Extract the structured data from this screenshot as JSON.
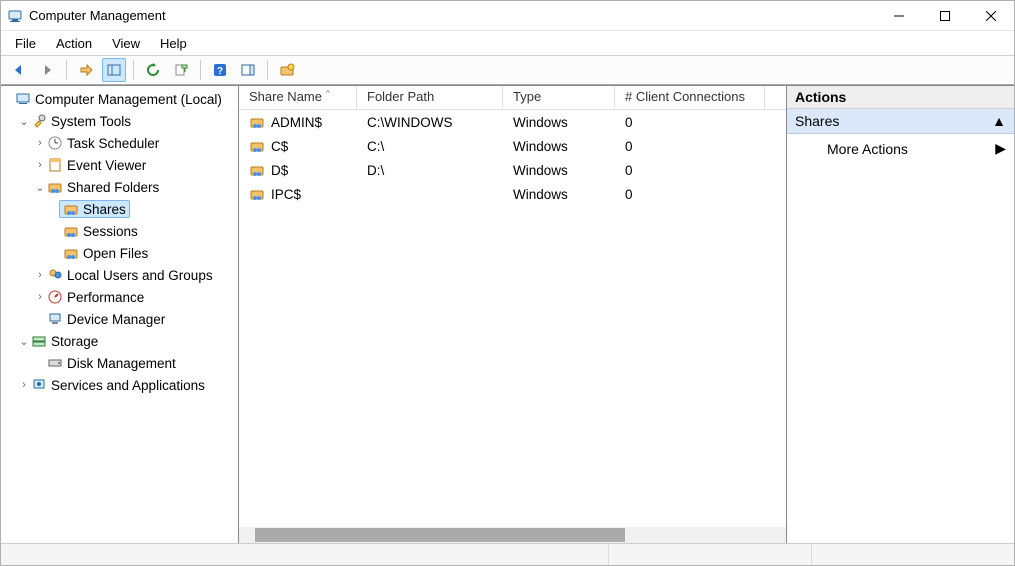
{
  "titlebar": {
    "title": "Computer Management"
  },
  "menubar": [
    "File",
    "Action",
    "View",
    "Help"
  ],
  "tree": {
    "root": "Computer Management (Local)",
    "system_tools": "System Tools",
    "task_scheduler": "Task Scheduler",
    "event_viewer": "Event Viewer",
    "shared_folders": "Shared Folders",
    "shares": "Shares",
    "sessions": "Sessions",
    "open_files": "Open Files",
    "local_users": "Local Users and Groups",
    "performance": "Performance",
    "device_manager": "Device Manager",
    "storage": "Storage",
    "disk_management": "Disk Management",
    "services_apps": "Services and Applications"
  },
  "list": {
    "columns": {
      "share_name": "Share Name",
      "folder_path": "Folder Path",
      "type": "Type",
      "connections": "# Client Connections"
    },
    "rows": [
      {
        "name": "ADMIN$",
        "path": "C:\\WINDOWS",
        "type": "Windows",
        "conn": "0"
      },
      {
        "name": "C$",
        "path": "C:\\",
        "type": "Windows",
        "conn": "0"
      },
      {
        "name": "D$",
        "path": "D:\\",
        "type": "Windows",
        "conn": "0"
      },
      {
        "name": "IPC$",
        "path": "",
        "type": "Windows",
        "conn": "0"
      }
    ]
  },
  "actions": {
    "header": "Actions",
    "section": "Shares",
    "more": "More Actions"
  }
}
